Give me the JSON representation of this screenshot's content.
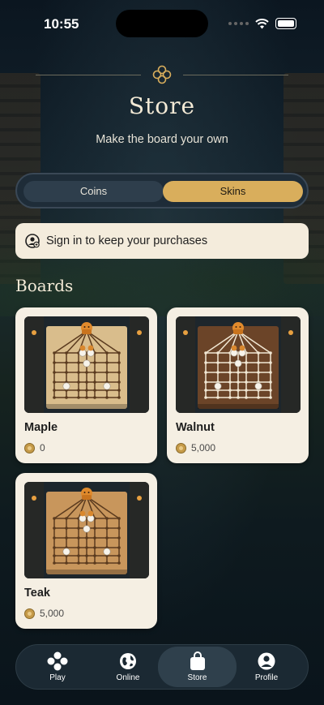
{
  "status_bar": {
    "time": "10:55"
  },
  "header": {
    "title": "Store",
    "subtitle": "Make the board your own"
  },
  "segmented": {
    "options": [
      "Coins",
      "Skins"
    ],
    "selected": "Skins"
  },
  "signin": {
    "label": "Sign in to keep your purchases"
  },
  "section": {
    "title": "Boards"
  },
  "boards": [
    {
      "name": "Maple",
      "price": "0",
      "board_color": "#d9bd8c",
      "line_color": "#5a3a1e"
    },
    {
      "name": "Walnut",
      "price": "5,000",
      "board_color": "#6b4428",
      "line_color": "#f2e8d4"
    },
    {
      "name": "Teak",
      "price": "5,000",
      "board_color": "#c8965c",
      "line_color": "#5a3a1e"
    }
  ],
  "tabbar": {
    "items": [
      {
        "label": "Play",
        "icon": "play-icon"
      },
      {
        "label": "Online",
        "icon": "globe-icon"
      },
      {
        "label": "Store",
        "icon": "shopping-bag-icon"
      },
      {
        "label": "Profile",
        "icon": "profile-icon"
      }
    ],
    "active": "Store"
  },
  "colors": {
    "accent": "#d9ae5c",
    "card": "#f5efe3",
    "background": "#0d1a24"
  }
}
